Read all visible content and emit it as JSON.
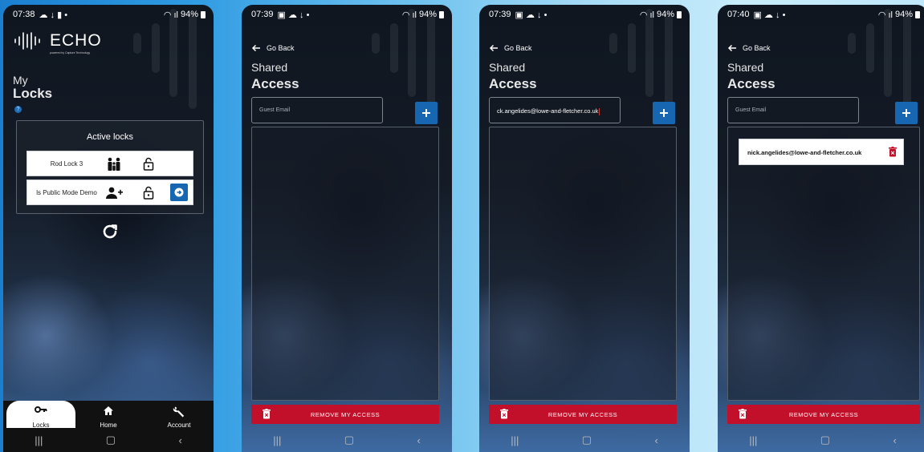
{
  "screen1": {
    "status": {
      "time": "07:38",
      "battery": "94%"
    },
    "brand": {
      "name": "ECHO",
      "tagline": "powered by Capture Technology"
    },
    "title_line1": "My",
    "title_line2": "Locks",
    "panel_title": "Active locks",
    "locks": [
      {
        "name": "Rod Lock 3",
        "people_icon": "family-icon",
        "lock_icon": "padlock-open-icon"
      },
      {
        "name": "ls Public Mode Demo",
        "people_icon": "add-person-icon",
        "lock_icon": "padlock-open-icon",
        "action_icon": "arrow-right-circle-icon"
      }
    ],
    "nav": [
      {
        "label": "Locks",
        "icon": "key-icon",
        "active": true
      },
      {
        "label": "Home",
        "icon": "home-icon",
        "active": false
      },
      {
        "label": "Account",
        "icon": "wrench-icon",
        "active": false
      }
    ]
  },
  "screen2": {
    "status": {
      "time": "07:39",
      "battery": "94%"
    },
    "back_label": "Go Back",
    "title_line1": "Shared",
    "title_line2": "Access",
    "email_placeholder": "Guest Email",
    "remove_label": "REMOVE MY ACCESS"
  },
  "screen3": {
    "status": {
      "time": "07:39",
      "battery": "94%"
    },
    "back_label": "Go Back",
    "title_line1": "Shared",
    "title_line2": "Access",
    "email_value": "ck.angelides@lowe-and-fletcher.co.uk",
    "remove_label": "REMOVE MY ACCESS"
  },
  "screen4": {
    "status": {
      "time": "07:40",
      "battery": "94%"
    },
    "back_label": "Go Back",
    "title_line1": "Shared",
    "title_line2": "Access",
    "email_placeholder": "Guest Email",
    "guests": [
      {
        "email": "nick.angelides@lowe-and-fletcher.co.uk"
      }
    ],
    "remove_label": "REMOVE MY ACCESS"
  },
  "colors": {
    "accent_blue": "#1766b2",
    "danger_red": "#c3102a"
  }
}
